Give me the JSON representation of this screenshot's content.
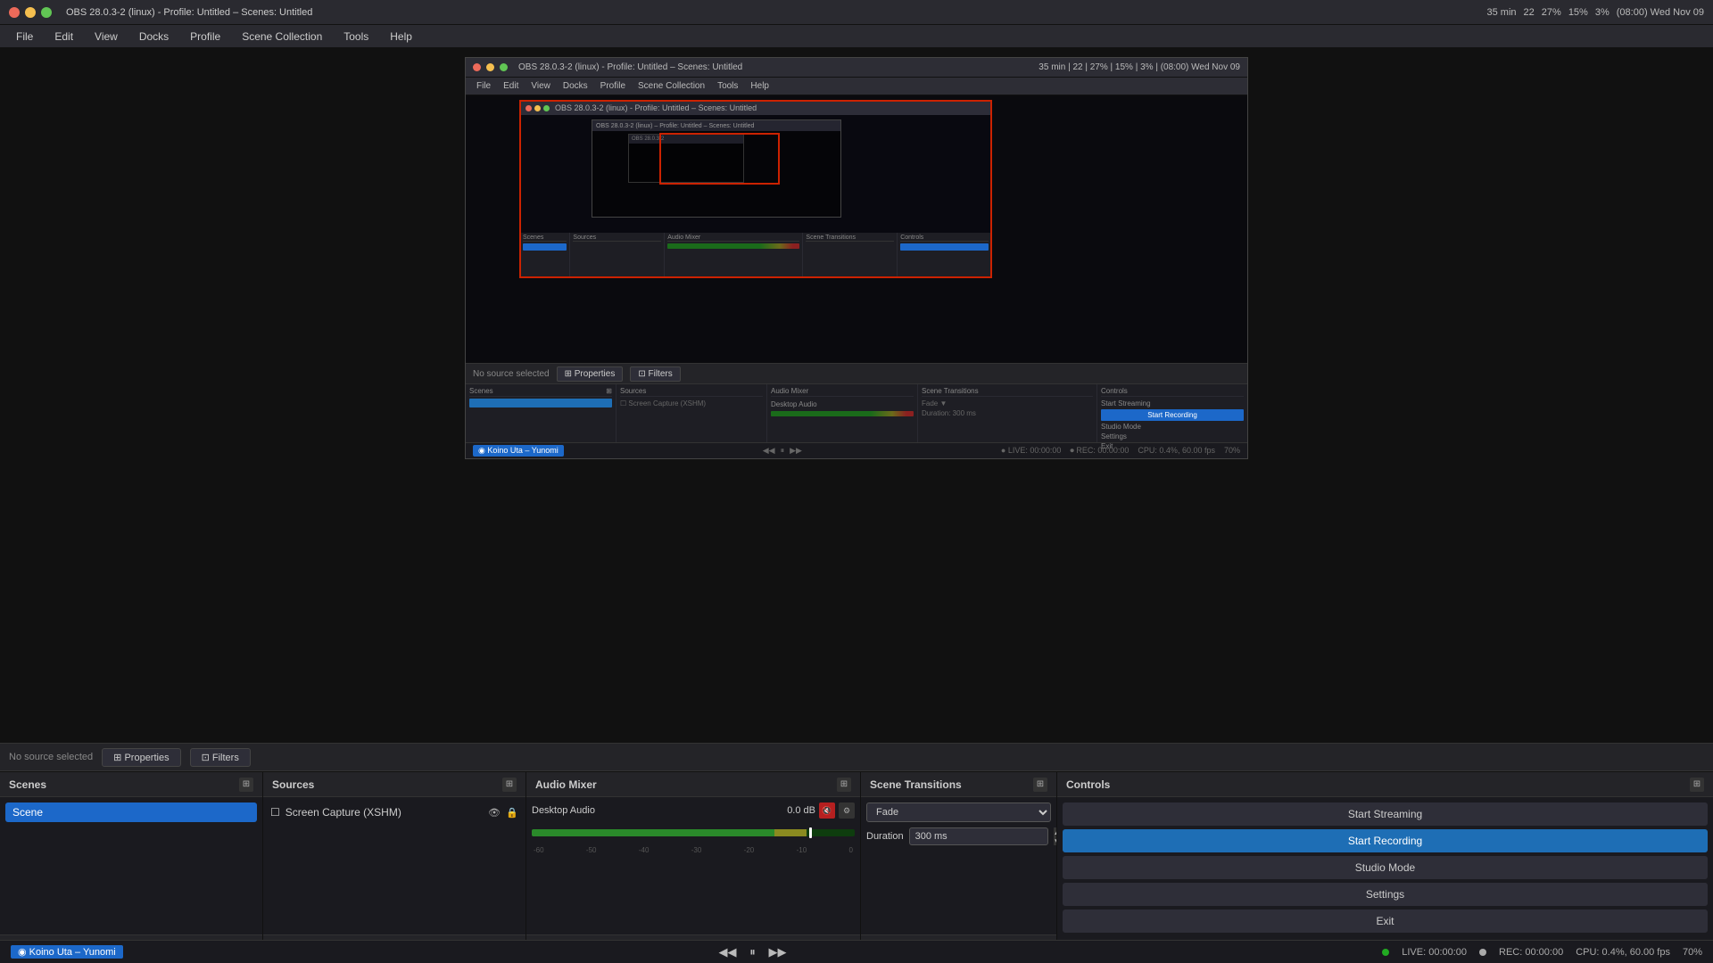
{
  "titlebar": {
    "title": "OBS 28.0.3-2 (linux) - Profile: Untitled – Scenes: Untitled",
    "dots": [
      "#ed6a5a",
      "#f5bf4f",
      "#61c554"
    ],
    "runtime": "35 min",
    "frames1": "22",
    "frames2": "27%",
    "cpu": "15%",
    "mem": "3%",
    "time": "(08:00) Wed Nov 09"
  },
  "menubar": {
    "items": [
      "File",
      "Edit",
      "View",
      "Docks",
      "Profile",
      "Scene Collection",
      "Tools",
      "Help"
    ]
  },
  "source_info": {
    "no_source": "No source selected",
    "properties_btn": "Properties",
    "filters_btn": "Filters"
  },
  "panels": {
    "scenes": {
      "title": "Scenes",
      "items": [
        "Scene"
      ],
      "add_btn": "+",
      "remove_btn": "−",
      "up_btn": "▲",
      "down_btn": "▼"
    },
    "sources": {
      "title": "Sources",
      "items": [
        {
          "name": "Screen Capture (XSHM)",
          "type": "monitor"
        }
      ],
      "add_btn": "+",
      "remove_btn": "−",
      "settings_btn": "⚙",
      "up_btn": "▲",
      "down_btn": "▼"
    },
    "audio_mixer": {
      "title": "Audio Mixer",
      "channel": {
        "name": "Desktop Audio",
        "db": "0.0 dB",
        "ticks": [
          "-60",
          "-50",
          "-40",
          "-30",
          "-20",
          "-10",
          "0"
        ]
      }
    },
    "scene_transitions": {
      "title": "Scene Transitions",
      "transition_type": "Fade",
      "duration_label": "Duration",
      "duration_value": "300 ms",
      "add_btn": "+",
      "remove_btn": "−",
      "more_btn": "⋯"
    },
    "controls": {
      "title": "Controls",
      "start_streaming_btn": "Start Streaming",
      "start_recording_btn": "Start Recording",
      "studio_mode_btn": "Studio Mode",
      "settings_btn": "Settings",
      "exit_btn": "Exit"
    }
  },
  "statusbar": {
    "music_label": "◉ Koino Uta – Yunomi",
    "play_btn": "◀◀",
    "pause_btn": "⏸",
    "next_btn": "▶▶",
    "live_label": "LIVE: 00:00:00",
    "rec_label": "REC: 00:00:00",
    "cpu_fps": "CPU: 0.4%, 60.00 fps",
    "zoom_label": "70%"
  },
  "preview": {
    "inner_title": "OBS 28.0.3-2 (linux) - Profile: Untitled – Scenes: Untitled",
    "inner_menu": [
      "File",
      "Edit",
      "View",
      "Docks",
      "Profile",
      "Scene Collection",
      "Tools",
      "Help"
    ],
    "innermost_title": "OBS 28.0.3-2 (linux) - Profile: Untitled – Scenes: Untitled",
    "zoom_level": "70%",
    "bottom_controls_label": "◉ Koino Uta – Yunomi"
  }
}
